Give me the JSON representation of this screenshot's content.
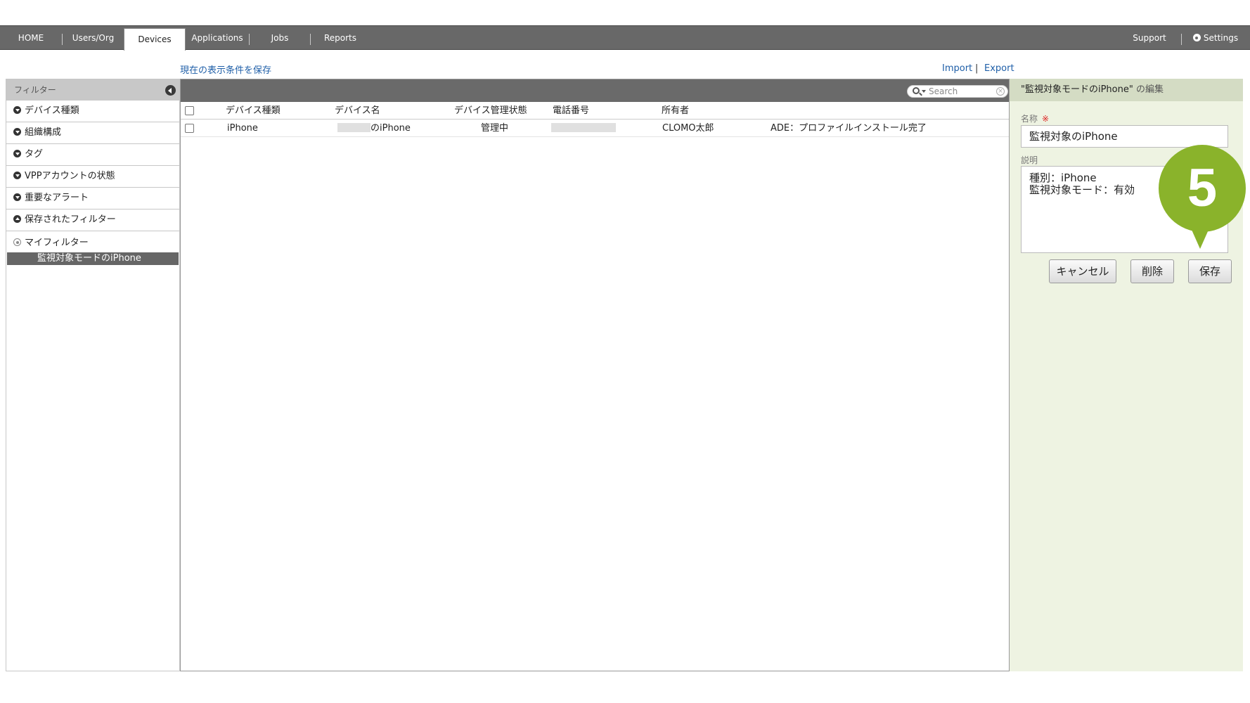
{
  "nav": {
    "tabs": [
      "HOME",
      "Users/Org",
      "Devices",
      "Applications",
      "Jobs",
      "Reports"
    ],
    "active_tab": "Devices",
    "support": "Support",
    "settings": "Settings"
  },
  "toolbar": {
    "save_conditions": "現在の表示条件を保存",
    "import": "Import",
    "separator": "|",
    "export": "Export"
  },
  "filter": {
    "title": "フィルター",
    "items": [
      "デバイス種類",
      "組織構成",
      "タグ",
      "VPPアカウントの状態",
      "重要なアラート",
      "保存されたフィルター"
    ],
    "my_filter": "マイフィルター",
    "selected": "監視対象モードのiPhone"
  },
  "search": {
    "placeholder": "Search"
  },
  "table": {
    "columns": [
      "デバイス種類",
      "デバイス名",
      "デバイス管理状態",
      "電話番号",
      "所有者"
    ],
    "rows": [
      {
        "type": "iPhone",
        "name": "のiPhone",
        "status": "管理中",
        "phone": "",
        "owner": "CLOMO太郎",
        "note": "ADE：プロファイルインストール完了"
      }
    ]
  },
  "edit": {
    "title": "\"監視対象モードのiPhone\"",
    "title_suffix": "の編集",
    "name_label": "名称",
    "required_mark": "※",
    "name_value": "監視対象のiPhone",
    "desc_label": "説明",
    "desc_line1": "種別：iPhone",
    "desc_line2": "監視対象モード：有効",
    "cancel": "キャンセル",
    "delete": "削除",
    "save": "保存"
  },
  "callout": {
    "number": "5"
  },
  "colors": {
    "nav_bg": "#686868",
    "edit_bg": "#eef3e2",
    "callout": "#8ab32b",
    "link": "#1f5fa8"
  }
}
